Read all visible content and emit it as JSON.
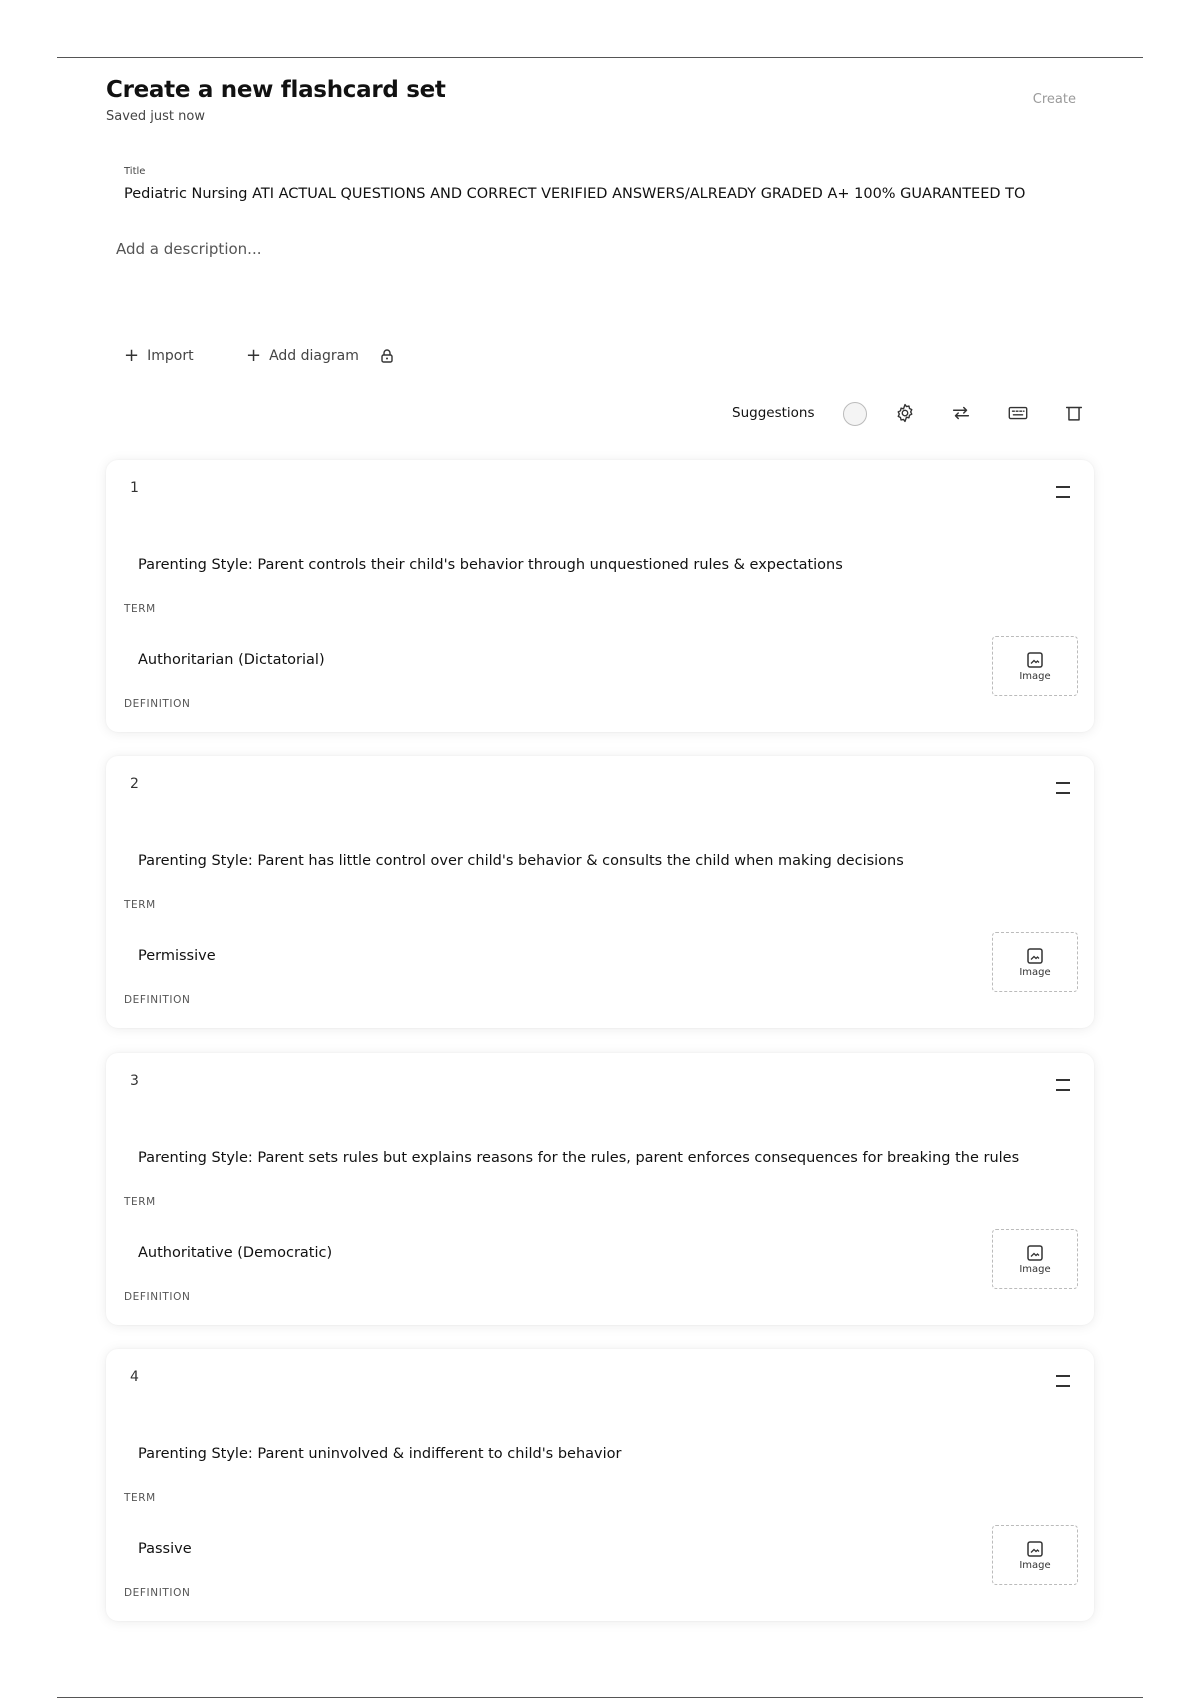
{
  "header": {
    "page_title": "Create a new flashcard set",
    "status": "Saved just now",
    "create_label": "Create"
  },
  "set": {
    "title_label": "Title",
    "title_value": "Pediatric Nursing ATI ACTUAL QUESTIONS AND CORRECT VERIFIED ANSWERS/ALREADY GRADED A+ 100% GUARANTEED TO",
    "description_placeholder": "Add a description..."
  },
  "tools": {
    "import_label": "Import",
    "add_diagram_label": "Add diagram"
  },
  "toolbar": {
    "suggestions_label": "Suggestions",
    "suggestions_enabled": false,
    "icons": [
      "gear-icon",
      "swap-icon",
      "keyboard-icon",
      "trash-icon"
    ]
  },
  "card_labels": {
    "term": "TERM",
    "definition": "DEFINITION",
    "image": "Image"
  },
  "cards": [
    {
      "number": "1",
      "term": "Parenting Style: Parent controls their child's behavior through unquestioned rules & expectations",
      "definition": "Authoritarian (Dictatorial)"
    },
    {
      "number": "2",
      "term": "Parenting Style: Parent has little control over child's behavior & consults the child when making decisions",
      "definition": "Permissive"
    },
    {
      "number": "3",
      "term": "Parenting Style: Parent sets rules but explains reasons for the rules, parent enforces consequences for breaking the rules",
      "definition": "Authoritative (Democratic)"
    },
    {
      "number": "4",
      "term": "Parenting Style: Parent uninvolved & indifferent to child's behavior",
      "definition": "Passive"
    }
  ]
}
